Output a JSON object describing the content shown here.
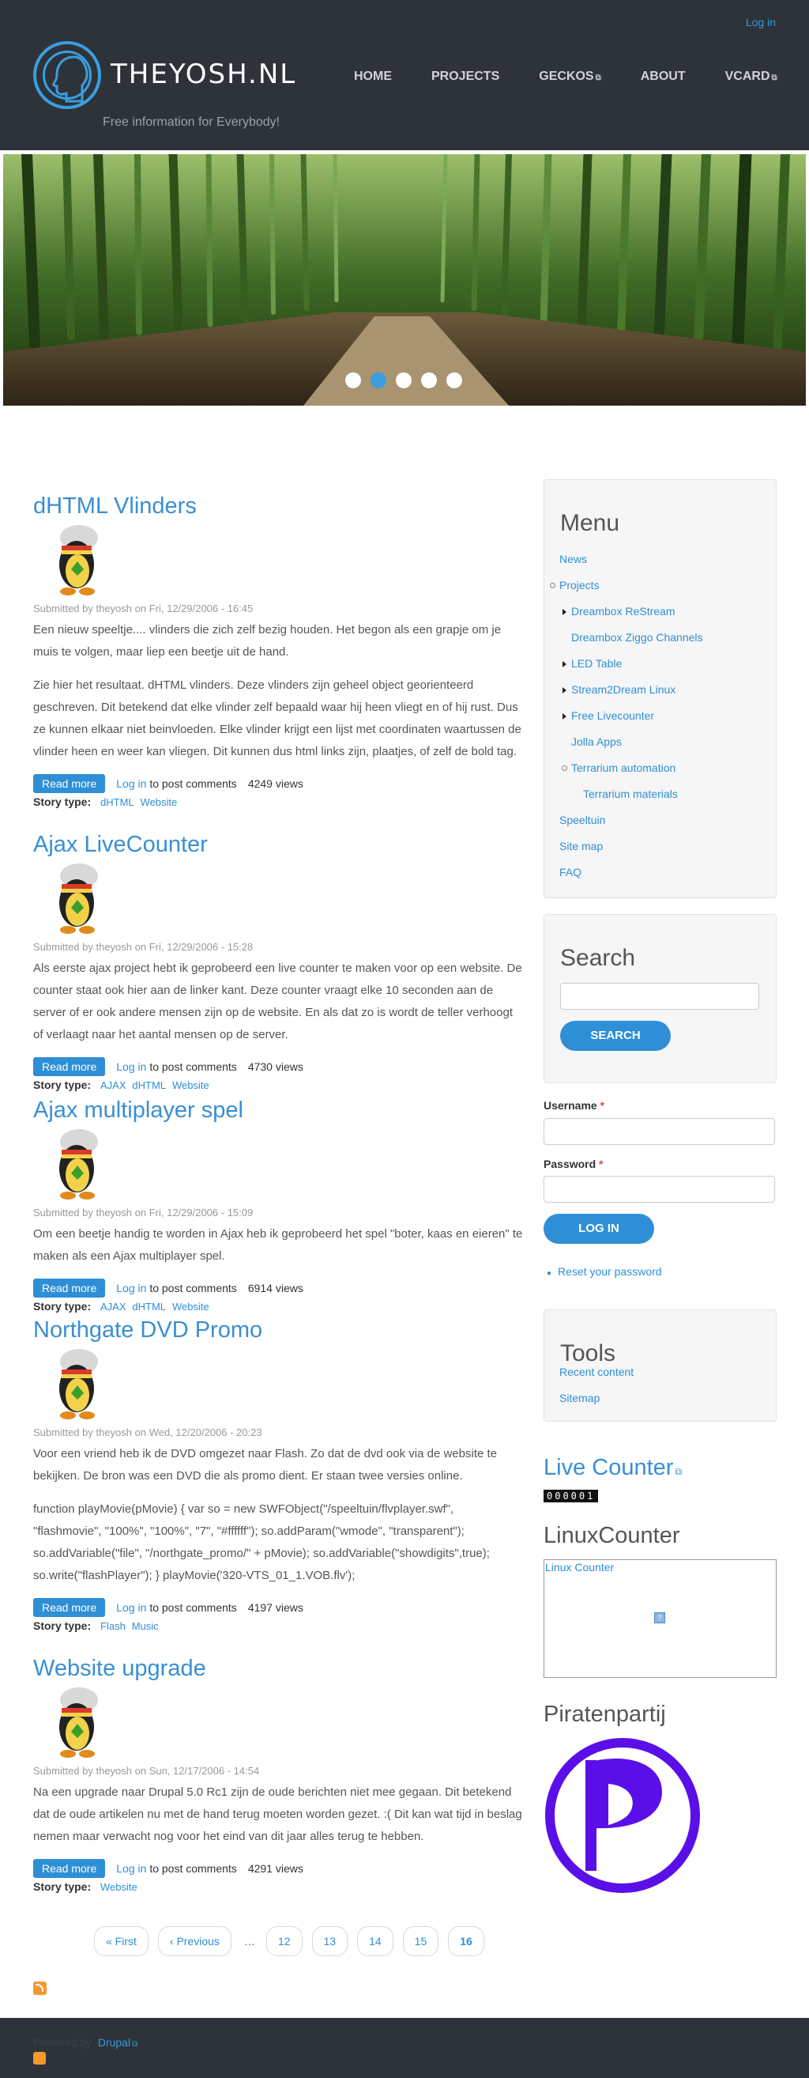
{
  "header": {
    "login_label": "Log in",
    "site_name": "THEYOSH.NL",
    "slogan": "Free information for Everybody!",
    "nav": [
      {
        "label": "HOME",
        "external": false
      },
      {
        "label": "PROJECTS",
        "external": false
      },
      {
        "label": "GECKOS",
        "external": true
      },
      {
        "label": "ABOUT",
        "external": false
      },
      {
        "label": "VCARD",
        "external": true
      }
    ]
  },
  "slider": {
    "dot_count": 5,
    "active_index": 1
  },
  "nodes": [
    {
      "title": "dHTML Vlinders",
      "submitted": "Submitted by theyosh on Fri, 12/29/2006 - 16:45",
      "paragraphs": [
        "Een nieuw speeltje.... vlinders die zich zelf bezig houden. Het begon als een grapje om je muis te volgen, maar liep een beetje uit de hand.",
        "Zie hier het resultaat. dHTML vlinders. Deze vlinders zijn geheel object georienteerd geschreven. Dit betekend dat elke vlinder zelf bepaald waar hij heen vliegt en of hij rust. Dus ze kunnen elkaar niet beinvloeden. Elke vlinder krijgt een lijst met coordinaten waartussen de vlinder heen en weer kan vliegen. Dit kunnen dus html links zijn, plaatjes, of zelf de bold tag."
      ],
      "read_more": "Read more",
      "login_label": "Log in",
      "comments_label": "to post comments",
      "views": "4249 views",
      "story_type_label": "Story type:",
      "tags": [
        "dHTML",
        "Website"
      ]
    },
    {
      "title": "Ajax LiveCounter",
      "submitted": "Submitted by theyosh on Fri, 12/29/2006 - 15:28",
      "paragraphs": [
        "Als eerste ajax project hebt ik geprobeerd een live counter te maken voor op een website. De counter staat ook hier aan de linker kant. Deze counter vraagt elke 10 seconden aan de server of er ook andere mensen zijn op de website. En als dat zo is wordt de teller verhoogt of verlaagt naar het aantal mensen op de server."
      ],
      "read_more": "Read more",
      "login_label": "Log in",
      "comments_label": "to post comments",
      "views": "4730 views",
      "story_type_label": "Story type:",
      "tags": [
        "AJAX",
        "dHTML",
        "Website"
      ]
    },
    {
      "title": "Ajax multiplayer spel",
      "submitted": "Submitted by theyosh on Fri, 12/29/2006 - 15:09",
      "paragraphs": [
        "Om een beetje handig te worden in Ajax heb ik geprobeerd het spel \"boter, kaas en eieren\" te maken als een Ajax multiplayer spel."
      ],
      "read_more": "Read more",
      "login_label": "Log in",
      "comments_label": "to post comments",
      "views": "6914 views",
      "story_type_label": "Story type:",
      "tags": [
        "AJAX",
        "dHTML",
        "Website"
      ]
    },
    {
      "title": "Northgate DVD Promo",
      "submitted": "Submitted by theyosh on Wed, 12/20/2006 - 20:23",
      "paragraphs": [
        "Voor een vriend heb ik de DVD omgezet naar Flash. Zo dat de dvd ook via de website te bekijken. De bron was een DVD die als promo dient. Er staan twee versies online.",
        "function playMovie(pMovie) { var so = new SWFObject(\"/speeltuin/flvplayer.swf\", \"flashmovie\", \"100%\", \"100%\", \"7\", \"#ffffff\"); so.addParam(\"wmode\", \"transparent\"); so.addVariable(\"file\", \"/northgate_promo/\" + pMovie); so.addVariable(\"showdigits\",true); so.write(\"flashPlayer\"); } playMovie('320-VTS_01_1.VOB.flv');"
      ],
      "read_more": "Read more",
      "login_label": "Log in",
      "comments_label": "to post comments",
      "views": "4197 views",
      "story_type_label": "Story type:",
      "tags": [
        "Flash",
        "Music"
      ]
    },
    {
      "title": "Website upgrade",
      "submitted": "Submitted by theyosh on Sun, 12/17/2006 - 14:54",
      "paragraphs": [
        "Na een upgrade naar Drupal 5.0 Rc1 zijn de oude berichten niet mee gegaan. Dit betekend dat de oude artikelen nu met de hand terug moeten worden gezet. :( Dit kan wat tijd in beslag nemen maar verwacht nog voor het eind van dit jaar alles terug te hebben."
      ],
      "read_more": "Read more",
      "login_label": "Log in",
      "comments_label": "to post comments",
      "views": "4291 views",
      "story_type_label": "Story type:",
      "tags": [
        "Website"
      ]
    }
  ],
  "pager": {
    "first": "« First",
    "previous": "‹ Previous",
    "ellipsis": "…",
    "pages": [
      "12",
      "13",
      "14",
      "15",
      "16"
    ],
    "current": "16"
  },
  "sidebar": {
    "menu": {
      "title": "Menu",
      "items": [
        {
          "label": "News",
          "kind": "leaf"
        },
        {
          "label": "Projects",
          "kind": "open"
        },
        {
          "label": "Dreambox ReStream",
          "kind": "child"
        },
        {
          "label": "Dreambox Ziggo Channels",
          "kind": "leaf"
        },
        {
          "label": "LED Table",
          "kind": "child"
        },
        {
          "label": "Stream2Dream Linux",
          "kind": "child"
        },
        {
          "label": "Free Livecounter",
          "kind": "child"
        },
        {
          "label": "Jolla Apps",
          "kind": "leaf"
        },
        {
          "label": "Terrarium automation",
          "kind": "open"
        },
        {
          "label": "Terrarium materials",
          "kind": "leaf"
        },
        {
          "label": "Speeltuin",
          "kind": "leaf"
        },
        {
          "label": "Site map",
          "kind": "leaf"
        },
        {
          "label": "FAQ",
          "kind": "leaf"
        }
      ]
    },
    "search": {
      "title": "Search",
      "placeholder": "",
      "button": "SEARCH"
    },
    "login": {
      "username_label": "Username",
      "password_label": "Password",
      "required_mark": "*",
      "button": "LOG IN",
      "reset_link": "Reset your password"
    },
    "tools": {
      "title": "Tools",
      "items": [
        "Recent content",
        "Sitemap"
      ]
    },
    "live_counter": {
      "title": "Live Counter",
      "digits": "000001"
    },
    "linux_counter": {
      "title": "LinuxCounter",
      "link": "Linux Counter"
    },
    "piratenpartij": {
      "title": "Piratenpartij"
    }
  },
  "footer": {
    "powered_by": "Powered by",
    "drupal_link": "Drupal"
  },
  "colors": {
    "accent": "#2e8fd6",
    "header_bg": "#2d3339",
    "pirate": "#5a0fe8"
  }
}
